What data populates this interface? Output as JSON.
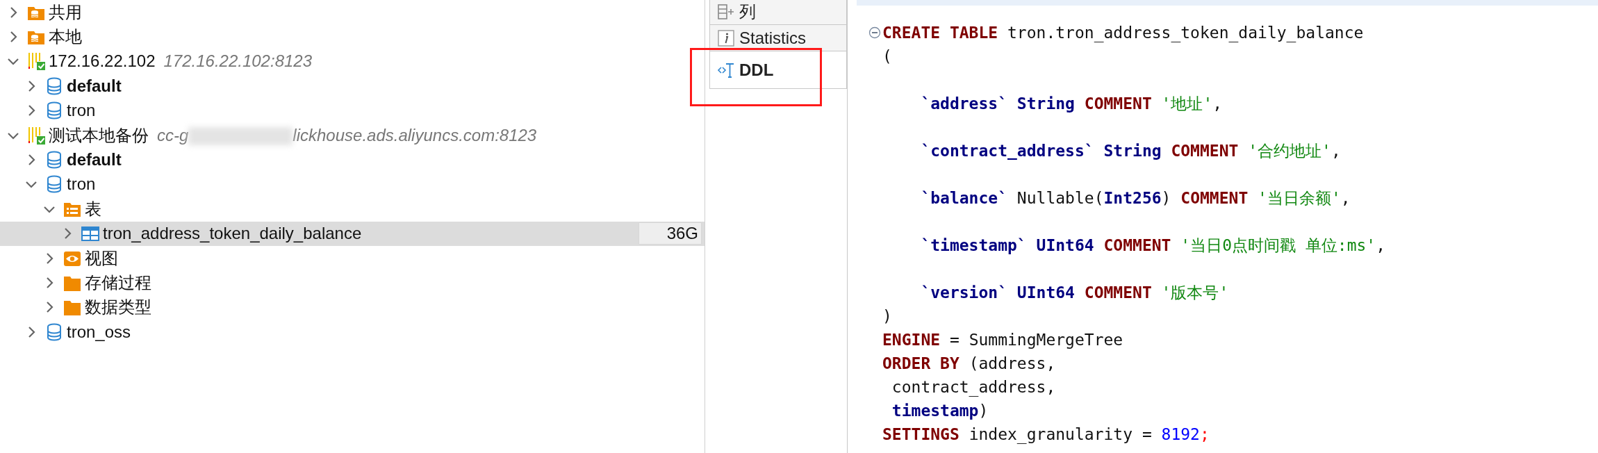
{
  "tree": [
    {
      "kind": "db-folder",
      "label": "共用",
      "expanded": false,
      "selected": false
    },
    {
      "kind": "db-folder",
      "label": "本地",
      "expanded": false,
      "selected": false
    },
    {
      "kind": "connection",
      "label": "172.16.22.102",
      "detail": [
        "172.16.22.102:8123"
      ],
      "expanded": true,
      "selected": false,
      "children": [
        {
          "kind": "database",
          "label": "default",
          "is_default": true,
          "expanded": false,
          "selected": false
        },
        {
          "kind": "database",
          "label": "tron",
          "is_default": false,
          "expanded": false,
          "selected": false
        }
      ]
    },
    {
      "kind": "connection",
      "label": "测试本地备份",
      "detail": [
        "cc-g",
        "lickhouse.ads.aliyuncs.com:8123"
      ],
      "expanded": true,
      "selected": false,
      "children": [
        {
          "kind": "database",
          "label": "default",
          "is_default": true,
          "expanded": false,
          "selected": false
        },
        {
          "kind": "database",
          "label": "tron",
          "is_default": false,
          "expanded": true,
          "selected": false,
          "children": [
            {
              "kind": "table-folder",
              "label": "表",
              "expanded": true,
              "selected": false,
              "children": [
                {
                  "kind": "table",
                  "label": "tron_address_token_daily_balance",
                  "size": "36G",
                  "expanded": false,
                  "selected": true
                }
              ]
            },
            {
              "kind": "view-folder",
              "label": "视图",
              "expanded": false,
              "selected": false
            },
            {
              "kind": "folder",
              "label": "存储过程",
              "expanded": false,
              "selected": false
            },
            {
              "kind": "folder",
              "label": "数据类型",
              "expanded": false,
              "selected": false
            }
          ]
        },
        {
          "kind": "database",
          "label": "tron_oss",
          "is_default": false,
          "expanded": false,
          "selected": false
        }
      ]
    }
  ],
  "tabs": [
    {
      "kind": "columns",
      "label": "列",
      "selected": false
    },
    {
      "kind": "info",
      "label": "Statistics",
      "selected": false
    },
    {
      "kind": "ddl",
      "label": "DDL",
      "selected": true
    }
  ],
  "ddl": [
    {
      "fold": true,
      "tokens": [
        {
          "kw": "CREATE TABLE"
        },
        {
          "plain": " tron.tron_address_token_daily_balance"
        }
      ]
    },
    {
      "tokens": [
        {
          "plain": "("
        }
      ]
    },
    {
      "spaced": true,
      "tokens": [
        {
          "ident": "    `address`"
        },
        {
          "type": " String"
        },
        {
          "kw": " COMMENT"
        },
        {
          "str": " '地址'"
        },
        {
          "plain": ","
        }
      ]
    },
    {
      "spaced": true,
      "tokens": [
        {
          "ident": "    `contract_address`"
        },
        {
          "type": " String"
        },
        {
          "kw": " COMMENT"
        },
        {
          "str": " '合约地址'"
        },
        {
          "plain": ","
        }
      ]
    },
    {
      "spaced": true,
      "tokens": [
        {
          "ident": "    `balance`"
        },
        {
          "plain": " Nullable("
        },
        {
          "type": "Int256"
        },
        {
          "plain": ")"
        },
        {
          "kw": " COMMENT"
        },
        {
          "str": " '当日余额'"
        },
        {
          "plain": ","
        }
      ]
    },
    {
      "spaced": true,
      "tokens": [
        {
          "ident": "    `timestamp`"
        },
        {
          "type": " UInt64"
        },
        {
          "kw": " COMMENT"
        },
        {
          "str": " '当日0点时间戳 单位:ms'"
        },
        {
          "plain": ","
        }
      ]
    },
    {
      "spaced": true,
      "tokens": [
        {
          "ident": "    `version`"
        },
        {
          "type": " UInt64"
        },
        {
          "kw": " COMMENT"
        },
        {
          "str": " '版本号'"
        }
      ]
    },
    {
      "tokens": [
        {
          "plain": ")"
        }
      ]
    },
    {
      "tokens": [
        {
          "kw": "ENGINE"
        },
        {
          "plain": " = SummingMergeTree"
        }
      ]
    },
    {
      "tokens": [
        {
          "kw": "ORDER BY"
        },
        {
          "plain": " (address,"
        }
      ]
    },
    {
      "tokens": [
        {
          "plain": " contract_address,"
        }
      ]
    },
    {
      "tokens": [
        {
          "type": " timestamp"
        },
        {
          "plain": ")"
        }
      ]
    },
    {
      "tokens": [
        {
          "kw": "SETTINGS"
        },
        {
          "plain": " index_granularity = "
        },
        {
          "num": "8192"
        },
        {
          "err": ";"
        }
      ]
    }
  ]
}
